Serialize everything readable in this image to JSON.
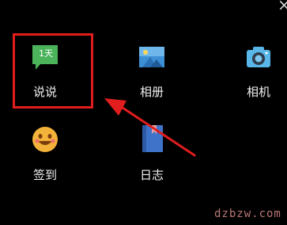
{
  "close_label": "×",
  "grid": [
    {
      "label": "说说",
      "badge": "1天",
      "icon": "shuoshuo-icon"
    },
    {
      "label": "相册",
      "icon": "album-icon"
    },
    {
      "label": "相机",
      "icon": "camera-icon"
    },
    {
      "label": "签到",
      "icon": "checkin-icon"
    },
    {
      "label": "日志",
      "icon": "diary-icon"
    }
  ],
  "watermark": "dzbzw.com",
  "colors": {
    "highlight": "#e11d1d",
    "shuoshuo": "#4bb45a",
    "album": "#3d8fd6",
    "camera": "#58b6e8",
    "checkin": "#f3b23a",
    "diary": "#3f73c9"
  }
}
